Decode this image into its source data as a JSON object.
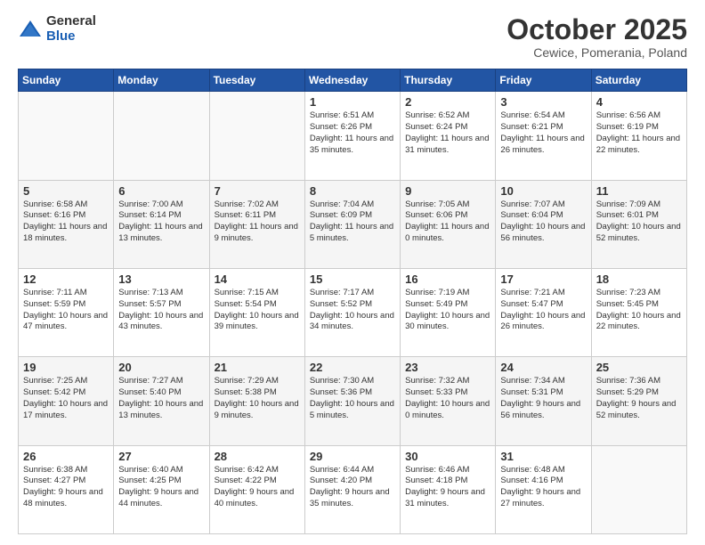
{
  "logo": {
    "general": "General",
    "blue": "Blue"
  },
  "header": {
    "title": "October 2025",
    "subtitle": "Cewice, Pomerania, Poland"
  },
  "days_of_week": [
    "Sunday",
    "Monday",
    "Tuesday",
    "Wednesday",
    "Thursday",
    "Friday",
    "Saturday"
  ],
  "weeks": [
    [
      {
        "day": "",
        "info": ""
      },
      {
        "day": "",
        "info": ""
      },
      {
        "day": "",
        "info": ""
      },
      {
        "day": "1",
        "info": "Sunrise: 6:51 AM\nSunset: 6:26 PM\nDaylight: 11 hours\nand 35 minutes."
      },
      {
        "day": "2",
        "info": "Sunrise: 6:52 AM\nSunset: 6:24 PM\nDaylight: 11 hours\nand 31 minutes."
      },
      {
        "day": "3",
        "info": "Sunrise: 6:54 AM\nSunset: 6:21 PM\nDaylight: 11 hours\nand 26 minutes."
      },
      {
        "day": "4",
        "info": "Sunrise: 6:56 AM\nSunset: 6:19 PM\nDaylight: 11 hours\nand 22 minutes."
      }
    ],
    [
      {
        "day": "5",
        "info": "Sunrise: 6:58 AM\nSunset: 6:16 PM\nDaylight: 11 hours\nand 18 minutes."
      },
      {
        "day": "6",
        "info": "Sunrise: 7:00 AM\nSunset: 6:14 PM\nDaylight: 11 hours\nand 13 minutes."
      },
      {
        "day": "7",
        "info": "Sunrise: 7:02 AM\nSunset: 6:11 PM\nDaylight: 11 hours\nand 9 minutes."
      },
      {
        "day": "8",
        "info": "Sunrise: 7:04 AM\nSunset: 6:09 PM\nDaylight: 11 hours\nand 5 minutes."
      },
      {
        "day": "9",
        "info": "Sunrise: 7:05 AM\nSunset: 6:06 PM\nDaylight: 11 hours\nand 0 minutes."
      },
      {
        "day": "10",
        "info": "Sunrise: 7:07 AM\nSunset: 6:04 PM\nDaylight: 10 hours\nand 56 minutes."
      },
      {
        "day": "11",
        "info": "Sunrise: 7:09 AM\nSunset: 6:01 PM\nDaylight: 10 hours\nand 52 minutes."
      }
    ],
    [
      {
        "day": "12",
        "info": "Sunrise: 7:11 AM\nSunset: 5:59 PM\nDaylight: 10 hours\nand 47 minutes."
      },
      {
        "day": "13",
        "info": "Sunrise: 7:13 AM\nSunset: 5:57 PM\nDaylight: 10 hours\nand 43 minutes."
      },
      {
        "day": "14",
        "info": "Sunrise: 7:15 AM\nSunset: 5:54 PM\nDaylight: 10 hours\nand 39 minutes."
      },
      {
        "day": "15",
        "info": "Sunrise: 7:17 AM\nSunset: 5:52 PM\nDaylight: 10 hours\nand 34 minutes."
      },
      {
        "day": "16",
        "info": "Sunrise: 7:19 AM\nSunset: 5:49 PM\nDaylight: 10 hours\nand 30 minutes."
      },
      {
        "day": "17",
        "info": "Sunrise: 7:21 AM\nSunset: 5:47 PM\nDaylight: 10 hours\nand 26 minutes."
      },
      {
        "day": "18",
        "info": "Sunrise: 7:23 AM\nSunset: 5:45 PM\nDaylight: 10 hours\nand 22 minutes."
      }
    ],
    [
      {
        "day": "19",
        "info": "Sunrise: 7:25 AM\nSunset: 5:42 PM\nDaylight: 10 hours\nand 17 minutes."
      },
      {
        "day": "20",
        "info": "Sunrise: 7:27 AM\nSunset: 5:40 PM\nDaylight: 10 hours\nand 13 minutes."
      },
      {
        "day": "21",
        "info": "Sunrise: 7:29 AM\nSunset: 5:38 PM\nDaylight: 10 hours\nand 9 minutes."
      },
      {
        "day": "22",
        "info": "Sunrise: 7:30 AM\nSunset: 5:36 PM\nDaylight: 10 hours\nand 5 minutes."
      },
      {
        "day": "23",
        "info": "Sunrise: 7:32 AM\nSunset: 5:33 PM\nDaylight: 10 hours\nand 0 minutes."
      },
      {
        "day": "24",
        "info": "Sunrise: 7:34 AM\nSunset: 5:31 PM\nDaylight: 9 hours\nand 56 minutes."
      },
      {
        "day": "25",
        "info": "Sunrise: 7:36 AM\nSunset: 5:29 PM\nDaylight: 9 hours\nand 52 minutes."
      }
    ],
    [
      {
        "day": "26",
        "info": "Sunrise: 6:38 AM\nSunset: 4:27 PM\nDaylight: 9 hours\nand 48 minutes."
      },
      {
        "day": "27",
        "info": "Sunrise: 6:40 AM\nSunset: 4:25 PM\nDaylight: 9 hours\nand 44 minutes."
      },
      {
        "day": "28",
        "info": "Sunrise: 6:42 AM\nSunset: 4:22 PM\nDaylight: 9 hours\nand 40 minutes."
      },
      {
        "day": "29",
        "info": "Sunrise: 6:44 AM\nSunset: 4:20 PM\nDaylight: 9 hours\nand 35 minutes."
      },
      {
        "day": "30",
        "info": "Sunrise: 6:46 AM\nSunset: 4:18 PM\nDaylight: 9 hours\nand 31 minutes."
      },
      {
        "day": "31",
        "info": "Sunrise: 6:48 AM\nSunset: 4:16 PM\nDaylight: 9 hours\nand 27 minutes."
      },
      {
        "day": "",
        "info": ""
      }
    ]
  ]
}
